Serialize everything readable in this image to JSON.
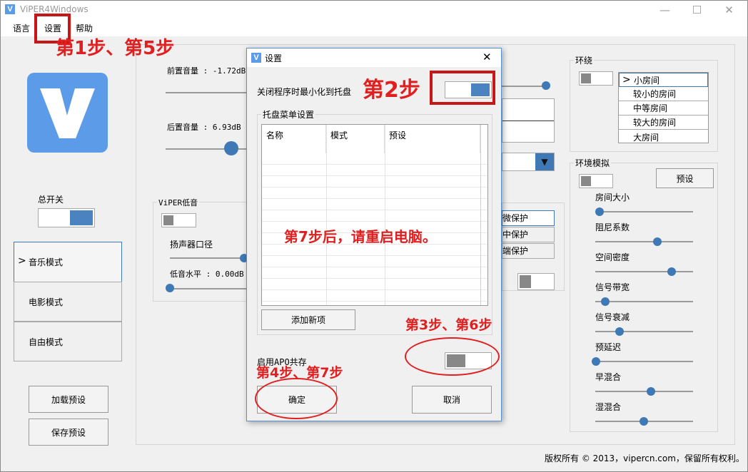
{
  "window": {
    "title": "ViPER4Windows",
    "app_icon_letter": "V",
    "min": "—",
    "max": "☐",
    "close": "✕"
  },
  "menu": {
    "language": "语言",
    "settings": "设置",
    "help": "帮助"
  },
  "main": {
    "master_switch_label": "总开关",
    "modes": [
      {
        "label": "音乐模式",
        "selected": true
      },
      {
        "label": "电影模式",
        "selected": false
      },
      {
        "label": "自由模式",
        "selected": false
      }
    ],
    "selected_marker": ">",
    "load_preset": "加载预设",
    "save_preset": "保存预设",
    "pre_volume": "前置音量 : -1.72dB",
    "post_volume": "后置音量 : 6.93dB",
    "viper_bass": {
      "title": "ViPER低音",
      "speaker_size": "扬声器口径",
      "bass_level": "低音水平 : 0.00dB"
    },
    "protection_items": [
      "微保护",
      "中保护",
      "端保护"
    ],
    "dropdown_arrow": "▼",
    "copyright": "版权所有 © 2013，vipercn.com，保留所有权利。"
  },
  "surround": {
    "title": "环绕",
    "rooms": [
      "小房间",
      "较小的房间",
      "中等房间",
      "较大的房间",
      "大房间"
    ],
    "selected_room": "小房间"
  },
  "env": {
    "title": "环境模拟",
    "preset": "预设",
    "params": [
      {
        "label": "房间大小",
        "value": 0.04
      },
      {
        "label": "阻尼系数",
        "value": 0.65
      },
      {
        "label": "空间密度",
        "value": 0.8
      },
      {
        "label": "信号带宽",
        "value": 0.1
      },
      {
        "label": "信号衰减",
        "value": 0.25
      },
      {
        "label": "预延迟",
        "value": 0.0
      },
      {
        "label": "早混合",
        "value": 0.58
      },
      {
        "label": "湿混合",
        "value": 0.5
      }
    ]
  },
  "dialog": {
    "title": "设置",
    "close": "✕",
    "minimize_to_tray": "关闭程序时最小化到托盘",
    "tray_menu_group": "托盘菜单设置",
    "columns": [
      "名称",
      "模式",
      "预设"
    ],
    "add_item": "添加新项",
    "enable_apo": "启用APO共存",
    "ok": "确定",
    "cancel": "取消"
  },
  "annotations": {
    "step_1_5": "第1步、第5步",
    "step_2": "第2步",
    "step_3_6": "第3步、第6步",
    "step_4_7": "第4步、第7步",
    "step_7_note": "第7步后，请重启电脑。"
  },
  "colors": {
    "accent": "#3f79b5",
    "annotation_red": "#e02020",
    "logo_blue": "#5b9be8"
  }
}
